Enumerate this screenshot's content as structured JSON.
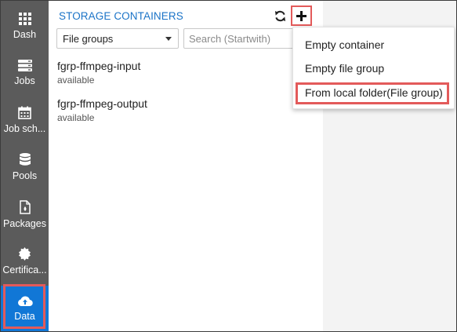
{
  "sidebar": {
    "items": [
      {
        "label": "Dash",
        "icon": "grid-icon"
      },
      {
        "label": "Jobs",
        "icon": "jobs-list-icon"
      },
      {
        "label": "Job sch...",
        "icon": "calendar-icon"
      },
      {
        "label": "Pools",
        "icon": "database-icon"
      },
      {
        "label": "Packages",
        "icon": "package-file-icon"
      },
      {
        "label": "Certifica...",
        "icon": "certificate-badge-icon"
      },
      {
        "label": "Data",
        "icon": "cloud-upload-icon",
        "active": true
      }
    ]
  },
  "panel": {
    "title": "STORAGE CONTAINERS",
    "filter_select": {
      "selected": "File groups"
    },
    "search": {
      "placeholder": "Search (Startwith)",
      "value": ""
    },
    "containers": [
      {
        "name": "fgrp-ffmpeg-input",
        "status": "available"
      },
      {
        "name": "fgrp-ffmpeg-output",
        "status": "available"
      }
    ]
  },
  "add_menu": {
    "items": [
      {
        "label": "Empty container"
      },
      {
        "label": "Empty file group"
      },
      {
        "label": "From local folder(File group)"
      }
    ]
  },
  "colors": {
    "sidebar_bg": "#5b5b5b",
    "accent_blue": "#1177d6",
    "title_blue": "#1a73c7",
    "highlight_red": "#e35a5a"
  }
}
